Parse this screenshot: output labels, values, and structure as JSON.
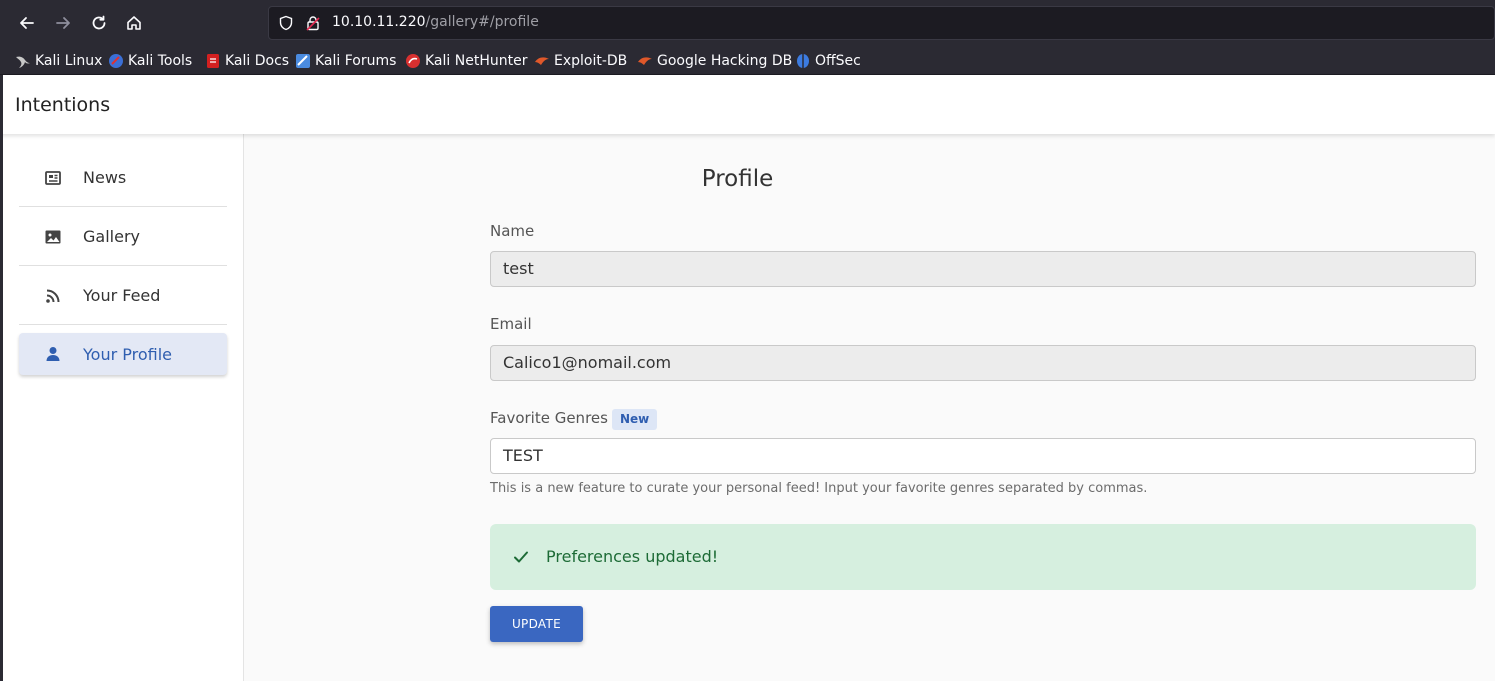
{
  "browser": {
    "url_host": "10.10.11.220",
    "url_path": "/gallery#/profile",
    "bookmarks": [
      {
        "label": "Kali Linux",
        "icon": "kali-dragon-icon",
        "color": "#1e1e1e"
      },
      {
        "label": "Kali Tools",
        "icon": "kali-tools-icon",
        "color": "#3b6fd6"
      },
      {
        "label": "Kali Docs",
        "icon": "kali-docs-icon",
        "color": "#d42020"
      },
      {
        "label": "Kali Forums",
        "icon": "kali-forums-icon",
        "color": "#4a8be0"
      },
      {
        "label": "Kali NetHunter",
        "icon": "nethunter-icon",
        "color": "#d83030"
      },
      {
        "label": "Exploit-DB",
        "icon": "exploit-db-icon",
        "color": "#e0582a"
      },
      {
        "label": "Google Hacking DB",
        "icon": "ghdb-icon",
        "color": "#e0582a"
      },
      {
        "label": "OffSec",
        "icon": "offsec-icon",
        "color": "#3c7be0"
      }
    ]
  },
  "app": {
    "title": "Intentions"
  },
  "sidebar": {
    "items": [
      {
        "label": "News",
        "icon": "newspaper-icon"
      },
      {
        "label": "Gallery",
        "icon": "image-icon"
      },
      {
        "label": "Your Feed",
        "icon": "rss-icon"
      },
      {
        "label": "Your Profile",
        "icon": "user-icon",
        "active": true
      }
    ]
  },
  "profile": {
    "heading": "Profile",
    "name_label": "Name",
    "name_value": "test",
    "email_label": "Email",
    "email_value": "Calico1@nomail.com",
    "genres_label": "Favorite Genres",
    "genres_badge": "New",
    "genres_value": "TEST",
    "genres_help": "This is a new feature to curate your personal feed! Input your favorite genres separated by commas.",
    "alert_text": "Preferences updated!",
    "update_label": "UPDATE"
  },
  "colors": {
    "accent": "#3a67c1",
    "success_bg": "#d6efdf",
    "success_text": "#1d6b36"
  }
}
